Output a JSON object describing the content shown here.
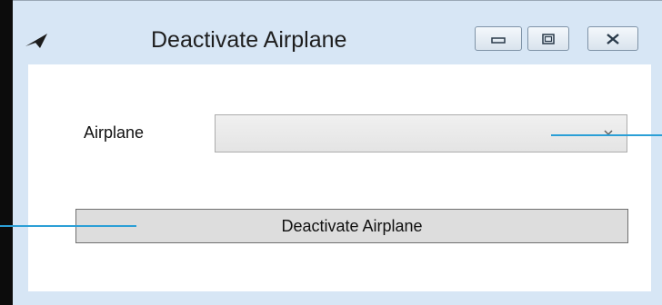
{
  "window": {
    "title": "Deactivate Airplane",
    "icon": "paper-plane-icon",
    "controls": [
      "minimize-icon",
      "maximize-icon",
      "close-icon"
    ]
  },
  "form": {
    "airplane_label": "Airplane",
    "airplane_select_value": "",
    "submit_label": "Deactivate Airplane"
  },
  "colors": {
    "frame": "#d7e6f5",
    "callout": "#2b9fd6",
    "button": "#dddddd"
  }
}
